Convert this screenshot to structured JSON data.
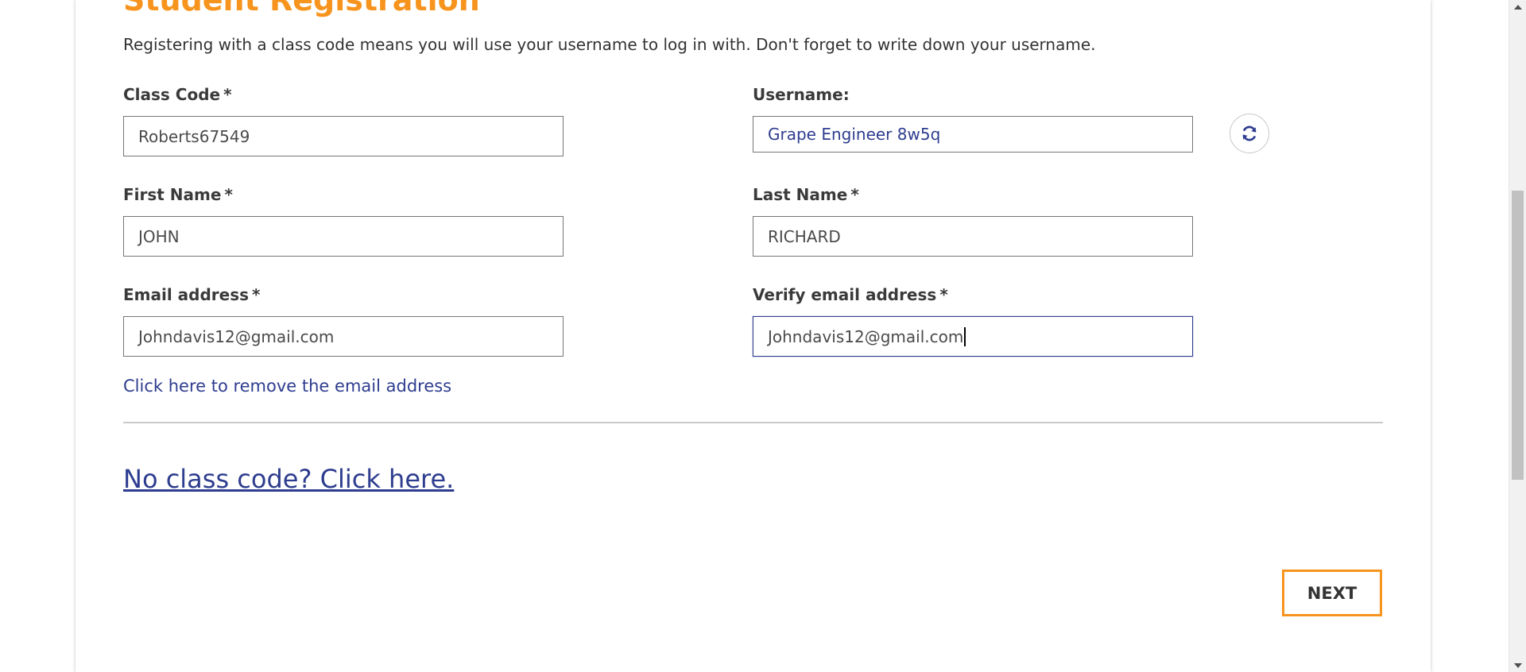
{
  "form": {
    "title": "Student Registration",
    "intro": "Registering with a class code means you will use your username to log in with. Don't forget to write down your username.",
    "required_marker": "*",
    "class_code": {
      "label": "Class Code",
      "value": "Roberts67549"
    },
    "username": {
      "label": "Username:",
      "value": "Grape Engineer 8w5q",
      "refresh_icon": "refresh-icon"
    },
    "first_name": {
      "label": "First Name",
      "value": "JOHN"
    },
    "last_name": {
      "label": "Last Name",
      "value": "RICHARD"
    },
    "email": {
      "label": "Email address",
      "value": "Johndavis12@gmail.com"
    },
    "verify_email": {
      "label": "Verify email address",
      "value": "Johndavis12@gmail.com"
    },
    "remove_email_link": "Click here to remove the email address",
    "no_class_code_link": "No class code? Click here.",
    "next_button": "NEXT"
  },
  "colors": {
    "accent_orange": "#f7941d",
    "link_blue": "#2e3d8f",
    "text_dark": "#333333"
  },
  "scrollbar": {
    "up_icon": "scroll-up-arrow-icon",
    "down_icon": "scroll-down-arrow-icon"
  }
}
